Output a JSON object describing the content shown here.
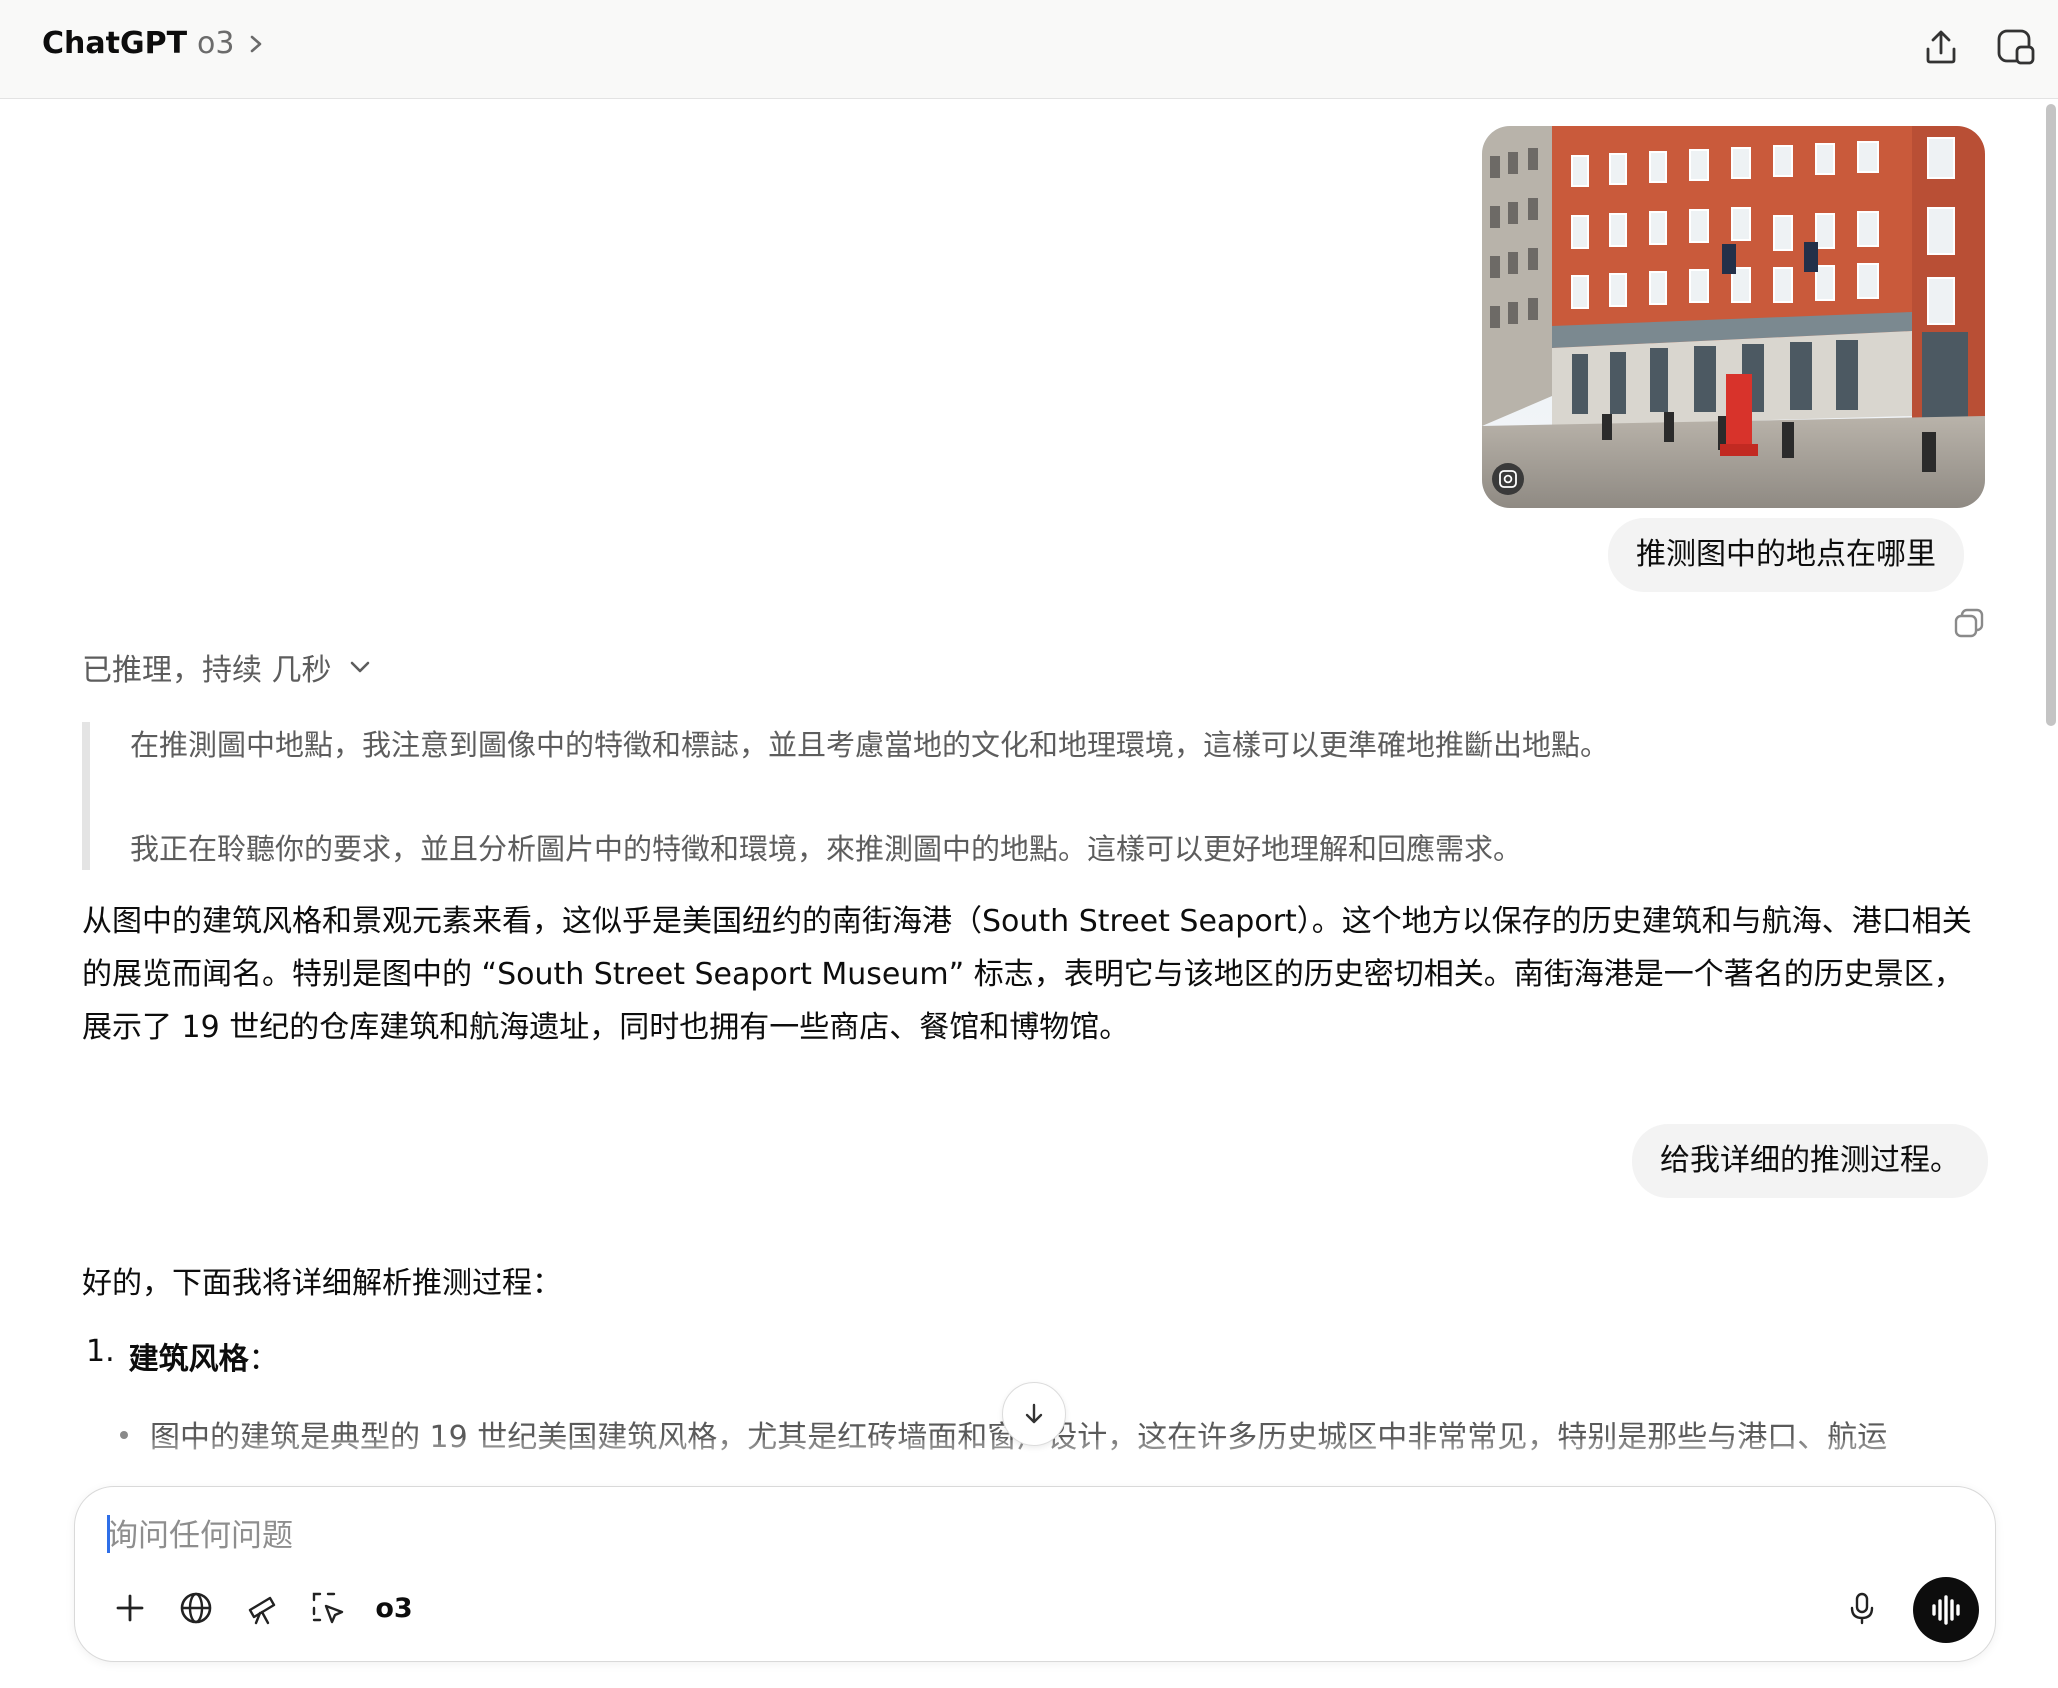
{
  "header": {
    "app_title": "ChatGPT",
    "model": "o3",
    "share_icon": "share-upload-icon",
    "new_chat_icon": "new-chat-icon"
  },
  "conversation": {
    "user_messages": [
      {
        "text": "推测图中的地点在哪里"
      },
      {
        "text": "给我详细的推测过程。"
      }
    ],
    "reasoning": {
      "label": "已推理，持续 几秒",
      "lines": [
        "在推測圖中地點，我注意到圖像中的特徵和標誌，並且考慮當地的文化和地理環境，這樣可以更準確地推斷出地點。",
        "我正在聆聽你的要求，並且分析圖片中的特徵和環境，來推測圖中的地點。這樣可以更好地理解和回應需求。"
      ]
    },
    "answer_1": "从图中的建筑风格和景观元素来看，这似乎是美国纽约的南街海港（South Street Seaport）。这个地方以保存的历史建筑和与航海、港口相关的展览而闻名。特别是图中的 “South Street Seaport Museum” 标志，表明它与该地区的历史密切相关。南街海港是一个著名的历史景区，展示了 19 世纪的仓库建筑和航海遗址，同时也拥有一些商店、餐馆和博物馆。",
    "answer_2_intro": "好的，下面我将详细解析推测过程：",
    "answer_2_list": [
      {
        "num": "1.",
        "title": "建筑风格",
        "suffix": "：",
        "bullets": [
          "图中的建筑是典型的 19 世纪美国建筑风格，尤其是红砖墙面和窗户设计，这在许多历史城区中非常常见，特别是那些与港口、航运"
        ]
      }
    ]
  },
  "composer": {
    "placeholder": "询问任何问题",
    "value": "",
    "model_label": "o3"
  },
  "colors": {
    "header_bg": "#f9f9f8",
    "bubble_bg": "#f3f3f3",
    "text": "#0d0d0d",
    "muted_text": "#5d5d5d",
    "voice_button": "#0d0d0d",
    "caret": "#2f6fe8"
  }
}
